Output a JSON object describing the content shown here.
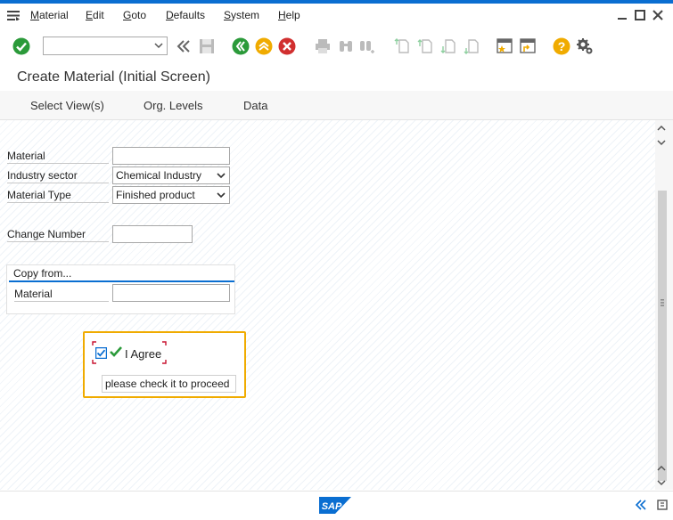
{
  "menu": {
    "items": [
      {
        "pre": "",
        "u": "M",
        "post": "aterial"
      },
      {
        "pre": "",
        "u": "E",
        "post": "dit"
      },
      {
        "pre": "",
        "u": "G",
        "post": "oto"
      },
      {
        "pre": "",
        "u": "D",
        "post": "efaults"
      },
      {
        "pre": "",
        "u": "S",
        "post": "ystem"
      },
      {
        "pre": "",
        "u": "H",
        "post": "elp"
      }
    ]
  },
  "toolbar": {
    "command_value": ""
  },
  "title": "Create Material (Initial Screen)",
  "appbar": {
    "buttons": [
      "Select View(s)",
      "Org. Levels",
      "Data"
    ]
  },
  "form": {
    "material_label": "Material",
    "material_value": "",
    "industry_label": "Industry sector",
    "industry_value": "Chemical Industry",
    "type_label": "Material Type",
    "type_value": "Finished product",
    "change_label": "Change Number",
    "change_value": ""
  },
  "copy": {
    "title": "Copy from...",
    "material_label": "Material",
    "material_value": ""
  },
  "agree": {
    "label": "I Agree",
    "checked": true,
    "hint": "please check it to proceed"
  },
  "status": {
    "logo": "SAP"
  },
  "colors": {
    "accent": "#0a6ed1",
    "highlight": "#f0ab00",
    "ok": "#2b9a3a",
    "cancel": "#d12f2f"
  }
}
